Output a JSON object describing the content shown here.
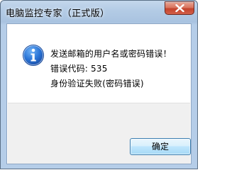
{
  "window": {
    "title": "电脑监控专家（正式版）"
  },
  "dialog": {
    "icon": "info-icon",
    "lines": [
      "发送邮箱的用户名或密码错误！",
      "错误代码: 535",
      "身份验证失败(密码错误)"
    ],
    "ok_label": "确定"
  },
  "colors": {
    "title_bar": "#b3cbe5",
    "close_button": "#c4432c",
    "info_icon": "#1f5fbf",
    "footer": "#f0f0f0",
    "button_border": "#3c7fb1"
  }
}
